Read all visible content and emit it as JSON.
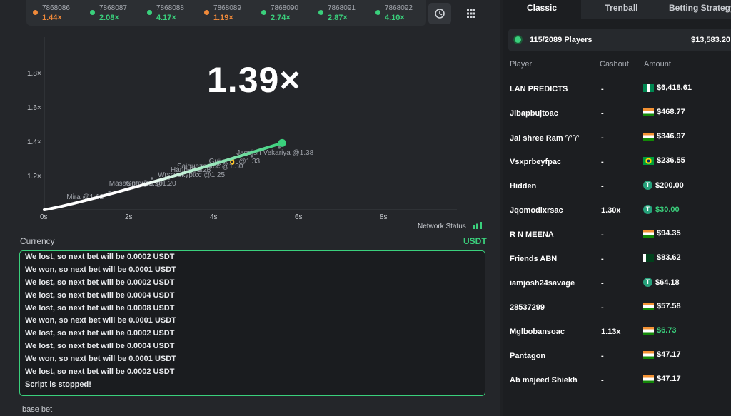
{
  "history": [
    {
      "id": "7868086",
      "mult": "1.44×",
      "color": "#f08a3a"
    },
    {
      "id": "7868087",
      "mult": "2.08×",
      "color": "#3ad07c"
    },
    {
      "id": "7868088",
      "mult": "4.17×",
      "color": "#3ad07c"
    },
    {
      "id": "7868089",
      "mult": "1.19×",
      "color": "#f08a3a"
    },
    {
      "id": "7868090",
      "mult": "2.74×",
      "color": "#3ad07c"
    },
    {
      "id": "7868091",
      "mult": "2.87×",
      "color": "#3ad07c"
    },
    {
      "id": "7868092",
      "mult": "4.10×",
      "color": "#3ad07c"
    }
  ],
  "icons": {
    "history": "clock-icon",
    "grid": "grid-icon"
  },
  "game": {
    "current_multiplier": "1.39×",
    "y_ticks": [
      "1.8×",
      "1.6×",
      "1.4×",
      "1.2×"
    ],
    "x_ticks": [
      "0s",
      "2s",
      "4s",
      "6s",
      "8s"
    ],
    "cashout_labels": [
      "Jagdish Vekariya @1.38",
      "Gujjar👌 @1.33",
      "Saiguezeptcc @1.30",
      "Harib @1.28",
      "Wrscvekyptcc @1.25",
      "Ggtouzu @1.20",
      "Masasina @1.20",
      "Mira @1.12"
    ],
    "network_status": "Network Status",
    "accent": "#3ad07c"
  },
  "currency": {
    "label": "Currency",
    "value": "USDT"
  },
  "log": [
    "We lost, so next bet will be 0.0002 USDT",
    "We won, so next bet will be 0.0001 USDT",
    "We lost, so next bet will be 0.0002 USDT",
    "We lost, so next bet will be 0.0004 USDT",
    "We lost, so next bet will be 0.0008 USDT",
    "We won, so next bet will be 0.0001 USDT",
    "We lost, so next bet will be 0.0002 USDT",
    "We lost, so next bet will be 0.0004 USDT",
    "We won, so next bet will be 0.0001 USDT",
    "We lost, so next bet will be 0.0002 USDT",
    "Script is stopped!"
  ],
  "base_bet_label": "base bet",
  "tabs": [
    "Classic",
    "Trenball",
    "Betting Strategy"
  ],
  "players_bar": {
    "count": "115/2089 Players",
    "total": "$13,583.20"
  },
  "columns": {
    "player": "Player",
    "cashout": "Cashout",
    "amount": "Amount"
  },
  "players": [
    {
      "name": "LAN PREDICTS",
      "cashout": "-",
      "amount": "$6,418.61",
      "flag": "ng",
      "win": false
    },
    {
      "name": "Jlbapbujtoac",
      "cashout": "-",
      "amount": "$468.77",
      "flag": "in",
      "win": false
    },
    {
      "name": "Jai shree Ram ♈♈",
      "cashout": "-",
      "amount": "$346.97",
      "flag": "in",
      "win": false
    },
    {
      "name": "Vsxprbeyfpac",
      "cashout": "-",
      "amount": "$236.55",
      "flag": "br",
      "win": false
    },
    {
      "name": "Hidden",
      "cashout": "-",
      "amount": "$200.00",
      "flag": "usdt",
      "win": false
    },
    {
      "name": "Jqomodixrsac",
      "cashout": "1.30x",
      "amount": "$30.00",
      "flag": "usdt",
      "win": true
    },
    {
      "name": "R N MEENA",
      "cashout": "-",
      "amount": "$94.35",
      "flag": "in",
      "win": false
    },
    {
      "name": "Friends ABN",
      "cashout": "-",
      "amount": "$83.62",
      "flag": "pk",
      "win": false
    },
    {
      "name": "iamjosh24savage",
      "cashout": "-",
      "amount": "$64.18",
      "flag": "usdt",
      "win": false
    },
    {
      "name": "28537299",
      "cashout": "-",
      "amount": "$57.58",
      "flag": "in",
      "win": false
    },
    {
      "name": "Mglbobansoac",
      "cashout": "1.13x",
      "amount": "$6.73",
      "flag": "in",
      "win": true
    },
    {
      "name": "Pantagon",
      "cashout": "-",
      "amount": "$47.17",
      "flag": "in",
      "win": false
    },
    {
      "name": "Ab majeed Shiekh",
      "cashout": "-",
      "amount": "$47.17",
      "flag": "in",
      "win": false
    }
  ]
}
